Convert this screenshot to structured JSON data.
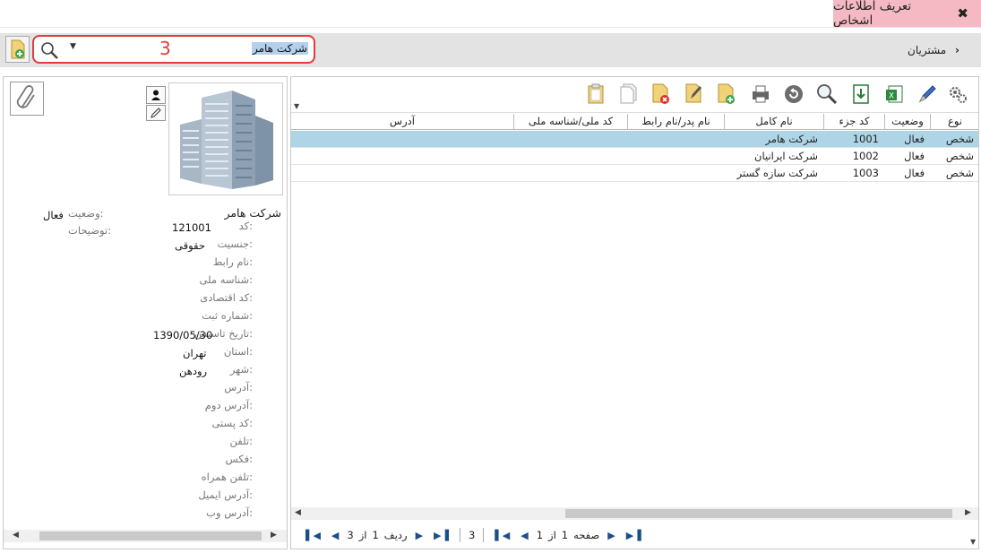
{
  "window": {
    "title": "تعریف اطلاعات اشخاص",
    "close_icon": "close-icon"
  },
  "search": {
    "value": "شرکت هامر",
    "count": "3",
    "icon": "search-icon",
    "dropdown_icon": "chevron-down-icon"
  },
  "breadcrumb": {
    "label": "مشتریان",
    "icon": "chevron-right-icon"
  },
  "grid": {
    "toolbar": [
      {
        "name": "settings-icon"
      },
      {
        "name": "edit-pen-icon"
      },
      {
        "name": "excel-export-icon"
      },
      {
        "name": "download-icon"
      },
      {
        "name": "search-icon"
      },
      {
        "name": "refresh-icon"
      },
      {
        "name": "print-icon"
      },
      {
        "name": "add-document-icon"
      },
      {
        "name": "edit-document-icon"
      },
      {
        "name": "delete-document-icon"
      },
      {
        "name": "copy-document-icon"
      },
      {
        "name": "paste-document-icon"
      }
    ],
    "columns": [
      "نوع",
      "وضعیت",
      "کد جزء",
      "نام کامل",
      "نام پدر/نام رابط",
      "کد ملی/شناسه ملی",
      "آدرس"
    ],
    "rows": [
      {
        "type": "شخص",
        "status": "فعال",
        "code": "1001",
        "name": "شرکت هامر",
        "father": "",
        "national": "",
        "address": "",
        "selected": true
      },
      {
        "type": "شخص",
        "status": "فعال",
        "code": "1002",
        "name": "شرکت ایرانیان",
        "father": "",
        "national": "",
        "address": "",
        "selected": false
      },
      {
        "type": "شخص",
        "status": "فعال",
        "code": "1003",
        "name": "شرکت سازه گستر",
        "father": "",
        "national": "",
        "address": "",
        "selected": false
      }
    ],
    "pager": {
      "page_label": "صفحه",
      "page_current": "1",
      "of_label": "از",
      "page_total": "1",
      "page_size": "3",
      "row_label": "ردیف",
      "row_current": "1",
      "row_of_label": "از",
      "row_total": "3"
    }
  },
  "detail": {
    "name": "شرکت هامر",
    "fields": [
      {
        "label": "کد:",
        "value": "121001"
      },
      {
        "label": "جنسیت:",
        "value": "حقوقی"
      },
      {
        "label": "نام رابط:",
        "value": ""
      },
      {
        "label": "شناسه ملی:",
        "value": ""
      },
      {
        "label": "کد اقتصادی:",
        "value": ""
      },
      {
        "label": "شماره ثبت:",
        "value": ""
      },
      {
        "label": "تاریخ تاسیس:",
        "value": "1390/05/30"
      },
      {
        "label": "استان:",
        "value": "تهران"
      },
      {
        "label": "شهر:",
        "value": "رودهن"
      },
      {
        "label": "آدرس:",
        "value": ""
      },
      {
        "label": "آدرس دوم:",
        "value": ""
      },
      {
        "label": "کد پستی:",
        "value": ""
      },
      {
        "label": "تلفن:",
        "value": ""
      },
      {
        "label": "فکس:",
        "value": ""
      },
      {
        "label": "تلفن همراه:",
        "value": ""
      },
      {
        "label": "آدرس ایمیل:",
        "value": ""
      },
      {
        "label": "آدرس وب:",
        "value": ""
      }
    ],
    "status_label": "وضعیت:",
    "status_value": "فعال",
    "notes_label": "توضیحات:"
  },
  "colors": {
    "title_tab": "#f5b9c3",
    "selected_row": "#aed5e6",
    "search_border": "#e23b3b",
    "toolbar_bg": "#e3e3e3"
  }
}
